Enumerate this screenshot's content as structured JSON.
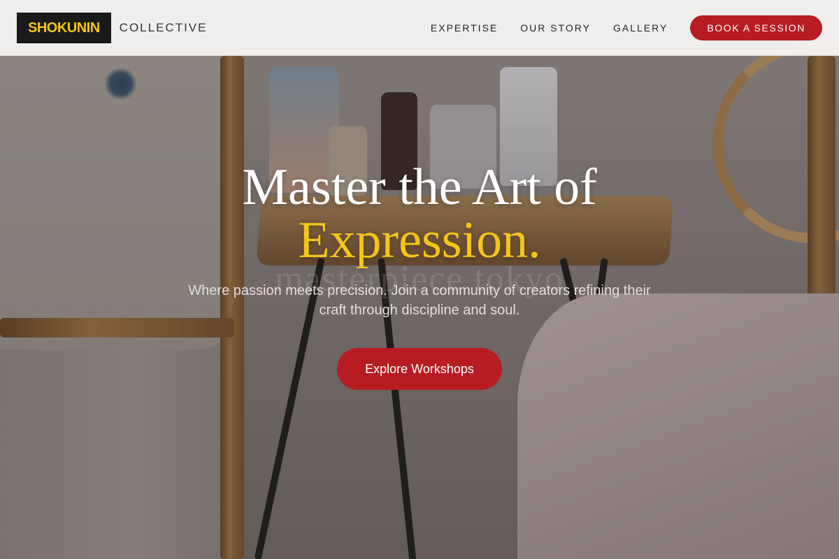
{
  "brand": {
    "name": "SHOKUNIN",
    "suffix": "COLLECTIVE"
  },
  "nav": {
    "items": [
      "EXPERTISE",
      "OUR STORY",
      "GALLERY"
    ],
    "cta_label": "BOOK A SESSION"
  },
  "hero": {
    "title_line1": "Master the Art of",
    "title_line2": "Expression.",
    "subtitle": "Where passion meets precision. Join a community of creators refining their craft through discipline and soul.",
    "cta_label": "Explore Workshops",
    "watermark": "masterpiece tokyo"
  },
  "colors": {
    "accent_red": "#b71c23",
    "accent_yellow": "#f5c518",
    "logo_bg": "#1a1a1a"
  }
}
